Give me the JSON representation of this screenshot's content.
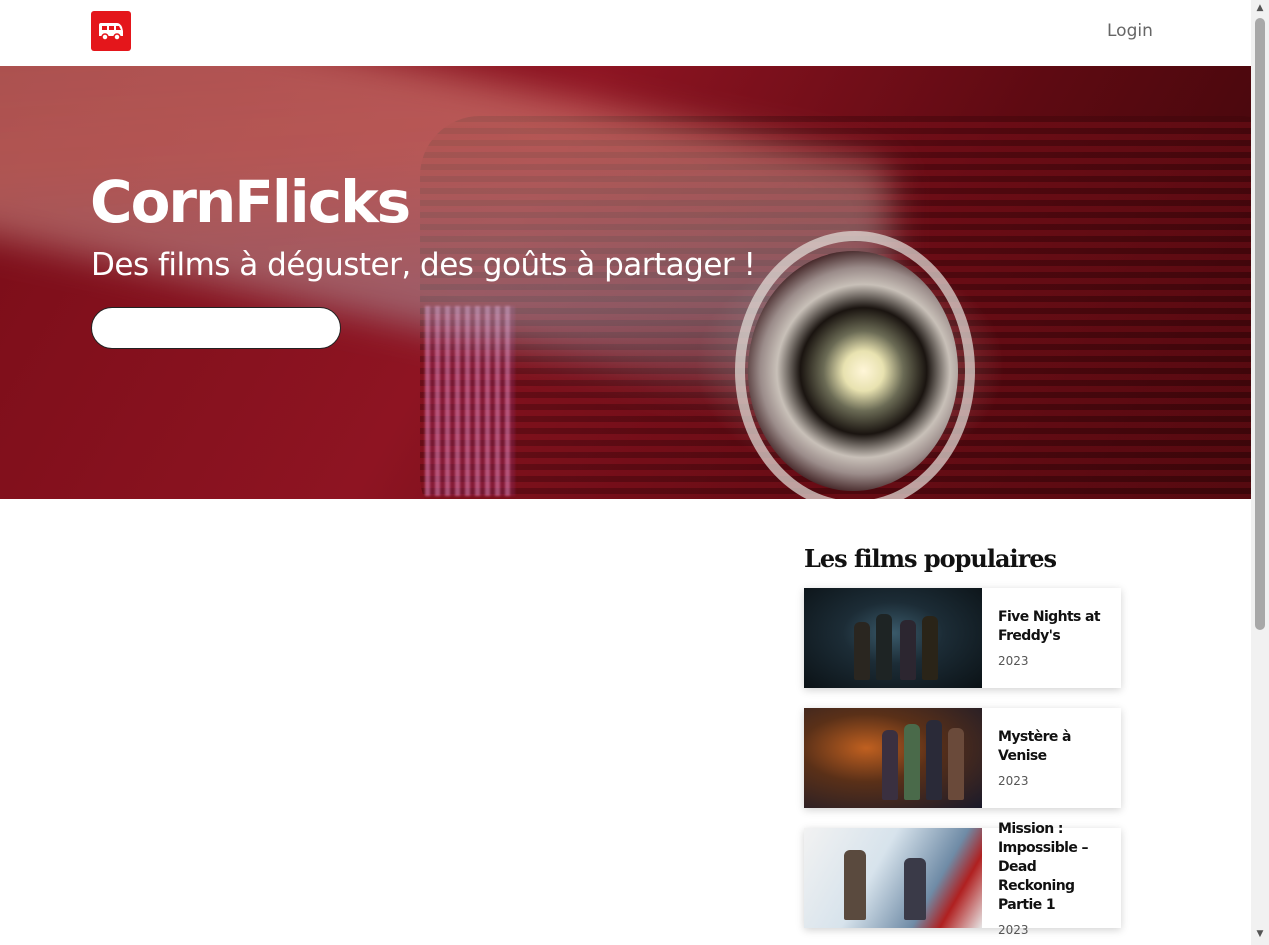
{
  "nav": {
    "logo_icon": "van-icon",
    "login_label": "Login"
  },
  "hero": {
    "title": "CornFlicks",
    "subtitle": "Des films à déguster, des goûts à partager !",
    "search_placeholder": ""
  },
  "popular": {
    "heading": "Les films populaires",
    "movies": [
      {
        "title": "Five Nights at Freddy's",
        "year": "2023"
      },
      {
        "title": "Mystère à Venise",
        "year": "2023"
      },
      {
        "title": "Mission : Impossible – Dead Reckoning Partie 1",
        "year": "2023"
      }
    ]
  },
  "colors": {
    "brand_red": "#e4161b"
  }
}
